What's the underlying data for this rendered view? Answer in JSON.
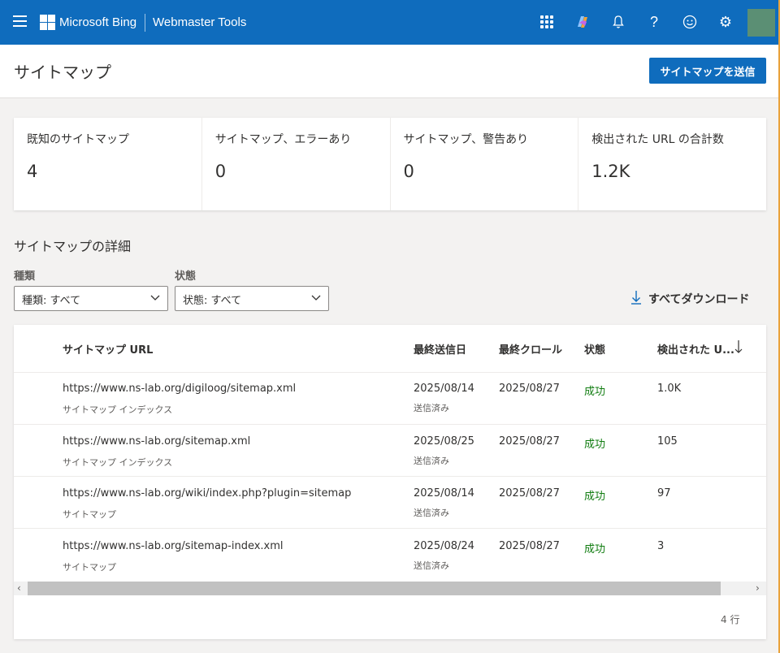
{
  "topbar": {
    "brand": "Microsoft Bing",
    "product": "Webmaster Tools",
    "icons": [
      "menu-icon",
      "apps-grid-icon",
      "copilot-icon",
      "bell-icon",
      "help-icon",
      "smiley-icon",
      "gear-icon"
    ]
  },
  "header": {
    "title": "サイトマップ",
    "submit_label": "サイトマップを送信"
  },
  "stats": [
    {
      "label": "既知のサイトマップ",
      "value": "4"
    },
    {
      "label": "サイトマップ、エラーあり",
      "value": "0"
    },
    {
      "label": "サイトマップ、警告あり",
      "value": "0"
    },
    {
      "label": "検出された URL の合計数",
      "value": "1.2K"
    }
  ],
  "details": {
    "title": "サイトマップの詳細",
    "type_label": "種類",
    "type_value": "種類: すべて",
    "status_label": "状態",
    "status_value": "状態: すべて",
    "download_label": "すべてダウンロード"
  },
  "table": {
    "headers": {
      "url": "サイトマップ URL",
      "last_submitted": "最終送信日",
      "last_crawl": "最終クロール",
      "status": "状態",
      "discovered": "検出された U..."
    },
    "rows": [
      {
        "url": "https://www.ns-lab.org/digiloog/sitemap.xml",
        "type": "サイトマップ インデックス",
        "submitted": "2025/08/14",
        "submitted_note": "送信済み",
        "crawled": "2025/08/27",
        "status": "成功",
        "discovered": "1.0K"
      },
      {
        "url": "https://www.ns-lab.org/sitemap.xml",
        "type": "サイトマップ インデックス",
        "submitted": "2025/08/25",
        "submitted_note": "送信済み",
        "crawled": "2025/08/27",
        "status": "成功",
        "discovered": "105"
      },
      {
        "url": "https://www.ns-lab.org/wiki/index.php?plugin=sitemap",
        "type": "サイトマップ",
        "submitted": "2025/08/14",
        "submitted_note": "送信済み",
        "crawled": "2025/08/27",
        "status": "成功",
        "discovered": "97"
      },
      {
        "url": "https://www.ns-lab.org/sitemap-index.xml",
        "type": "サイトマップ",
        "submitted": "2025/08/24",
        "submitted_note": "送信済み",
        "crawled": "2025/08/27",
        "status": "成功",
        "discovered": "3"
      }
    ],
    "row_count": "4 行"
  },
  "colors": {
    "accent": "#0f6cbd",
    "success": "#107c10"
  }
}
